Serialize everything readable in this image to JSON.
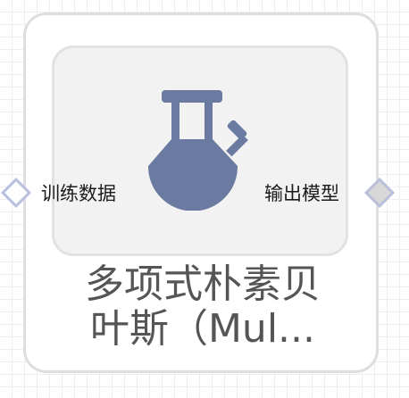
{
  "node": {
    "title_line1": "多项式朴素贝",
    "title_line2": "叶斯（Mul...",
    "icon": "flask-icon",
    "input_port": {
      "label": "训练数据"
    },
    "output_port": {
      "label": "输出模型"
    }
  },
  "colors": {
    "icon": "#6b7aa1",
    "port_border": "#b9c0dc",
    "title_text": "#555555"
  }
}
